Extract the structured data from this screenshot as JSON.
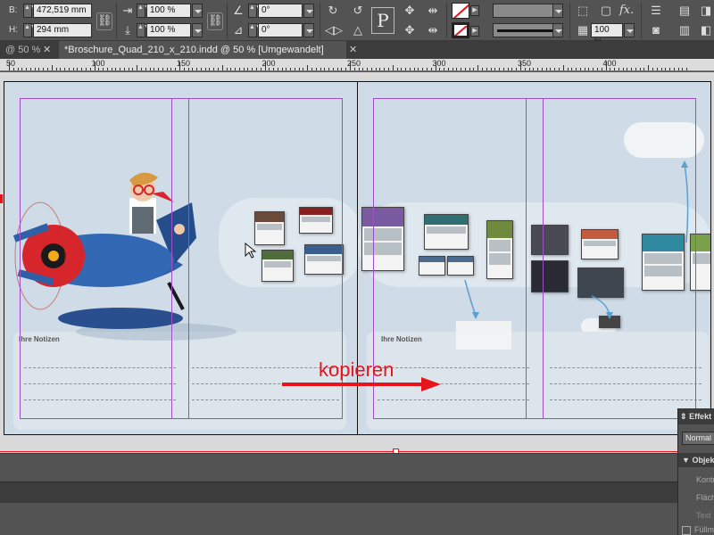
{
  "control_panel": {
    "b_label": "B:",
    "b_value": "472,519 mm",
    "h_label": "H:",
    "h_value": "294 mm",
    "scale_x": "100 %",
    "scale_y": "100 %",
    "rotate": "0°",
    "shear": "0°",
    "p_glyph": "P",
    "stroke_percent": "100 %",
    "fx_label": "fx."
  },
  "tabs": [
    {
      "label": "@ 50 %"
    },
    {
      "label": "*Broschure_Quad_210_x_210.indd @ 50 % [Umgewandelt]"
    }
  ],
  "ruler": {
    "labels": [
      "50",
      "100",
      "150",
      "200",
      "250",
      "300",
      "350",
      "400"
    ]
  },
  "canvas": {
    "left_page_notes_label": "Ihre Notizen",
    "right_page_notes_label": "Ihre Notizen",
    "annotation_text": "kopieren",
    "annotation_color": "#e8141c"
  },
  "effects_panel": {
    "title": "Effekt",
    "blend_mode": "Normal",
    "section": "Objekt",
    "items": [
      "Kontur",
      "Fläche",
      "Text"
    ],
    "footer": "Füllm"
  },
  "colors": {
    "accent_guide": "#a04ec8",
    "page_bg": "#cfdbe6",
    "ui_dark": "#535353"
  }
}
